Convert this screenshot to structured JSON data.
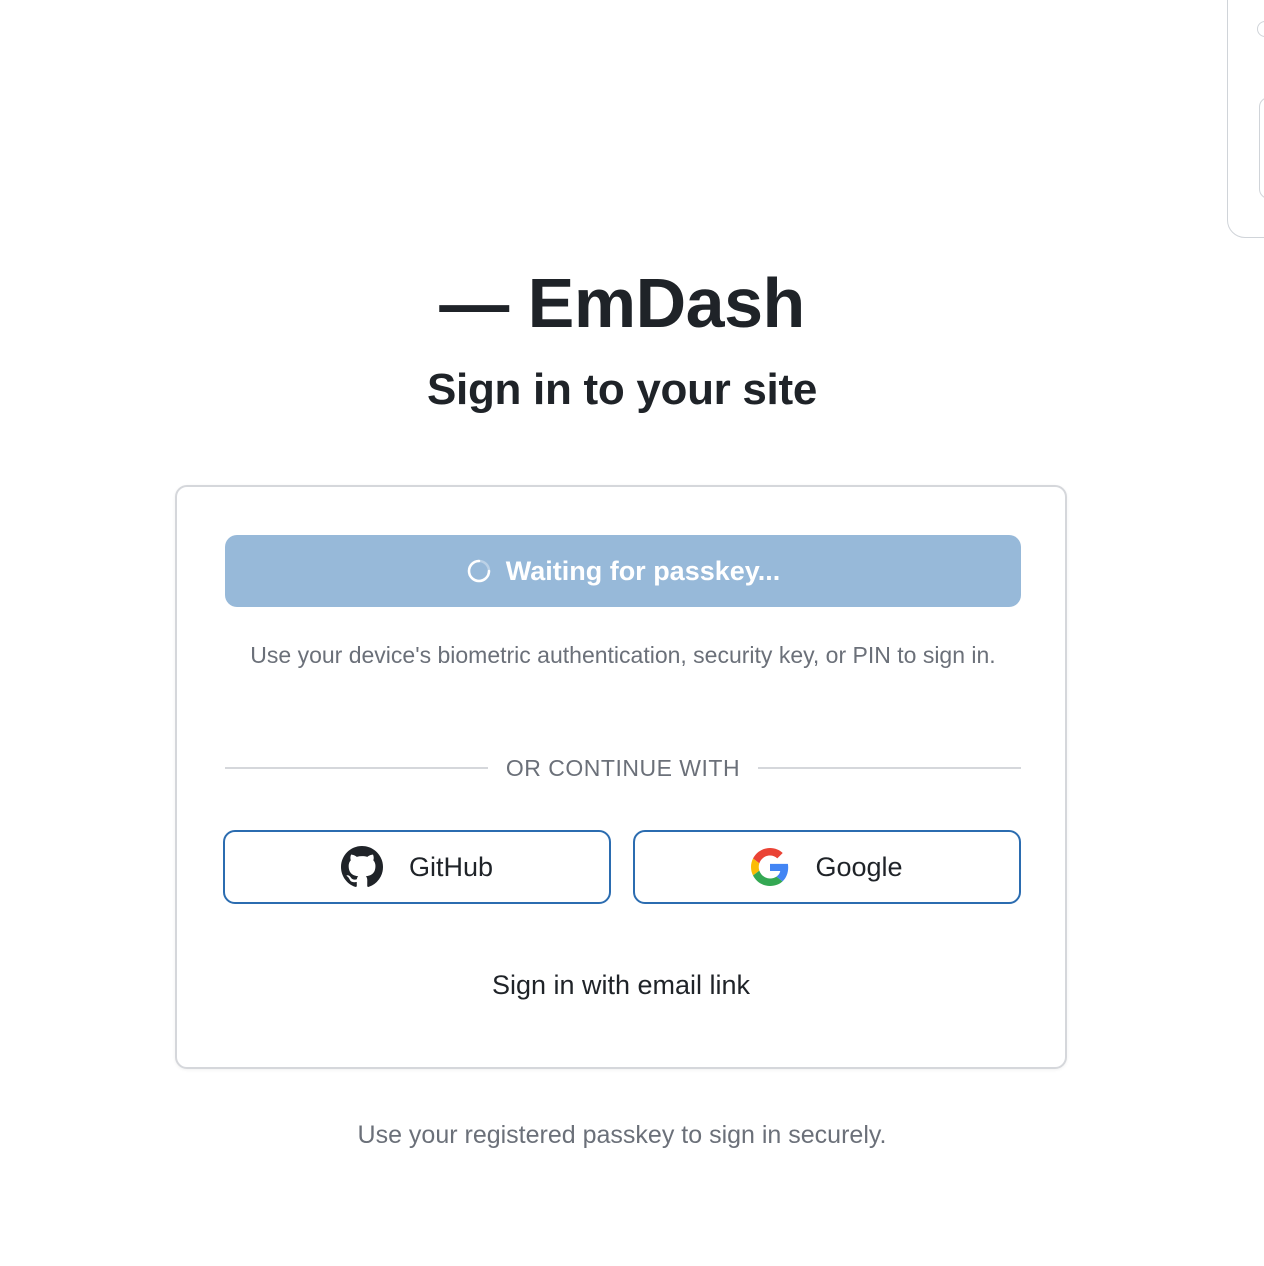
{
  "brand": {
    "title": "— EmDash"
  },
  "page": {
    "subtitle": "Sign in to your site",
    "footer_note": "Use your registered passkey to sign in securely."
  },
  "card": {
    "passkey_button_label": "Waiting for passkey...",
    "passkey_button_icon": "spinner-icon",
    "help_text": "Use your device's biometric authentication, security key, or PIN to sign in.",
    "divider_label": "OR CONTINUE WITH",
    "oauth": [
      {
        "label": "GitHub",
        "icon": "github-icon"
      },
      {
        "label": "Google",
        "icon": "google-icon"
      }
    ],
    "email_link_label": "Sign in with email link"
  },
  "colors": {
    "passkey_button_bg": "#97b9d9",
    "oauth_border": "#2b6cb0",
    "text_primary": "#1f2328",
    "text_muted": "#6b7079"
  }
}
